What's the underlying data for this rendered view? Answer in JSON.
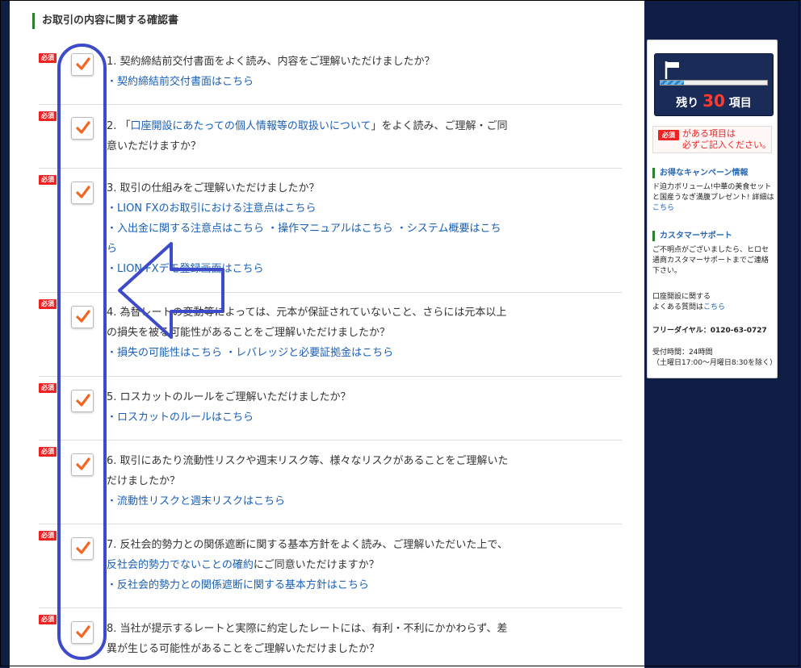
{
  "section_title": "お取引の内容に関する確認書",
  "required_badge": "必須",
  "questions": [
    {
      "text": "1. 契約締結前交付書面をよく読み、内容をご理解いただけましたか？",
      "links": [
        "・契約締結前交付書面はこちら"
      ],
      "checked": true
    },
    {
      "text_before": "2. 「",
      "text_link": "口座開設にあたっての個人情報等の取扱いについて",
      "text_after": "」をよく読み、ご理解・ご同意いただけますか？",
      "links": [],
      "checked": true
    },
    {
      "text": "3. 取引の仕組みをご理解いただけましたか？",
      "links": [
        "・LION FXのお取引における注意点はこちら",
        "・入出金に関する注意点はこちら",
        "・操作マニュアルはこちら",
        "・システム概要はこちら",
        "・LION FXデモ登録画面はこちら"
      ],
      "checked": true
    },
    {
      "text": "4. 為替レートの変動等によっては、元本が保証されていないこと、さらには元本以上の損失を被る可能性があることをご理解いただけましたか？",
      "links": [
        "・損失の可能性はこちら",
        "・レバレッジと必要証拠金はこちら"
      ],
      "checked": true
    },
    {
      "text": "5. ロスカットのルールをご理解いただけましたか？",
      "links": [
        "・ロスカットのルールはこちら"
      ],
      "checked": true
    },
    {
      "text": "6. 取引にあたり流動性リスクや週末リスク等、様々なリスクがあることをご理解いただけましたか？",
      "links": [
        "・流動性リスクと週末リスクはこちら"
      ],
      "checked": true
    },
    {
      "text_before": "7. 反社会的勢力との関係遮断に関する基本方針をよく読み、ご理解いただいた上で、",
      "text_link": "反社会的勢力でないことの確約",
      "text_after": "にご同意いただけますか？",
      "links": [
        "・反社会的勢力との関係遮断に関する基本方針はこちら"
      ],
      "checked": true
    },
    {
      "text": "8. 当社が提示するレートと実際に約定したレートには、有利・不利にかかわらず、差異が生じる可能性があることをご理解いただけましたか？",
      "links": [],
      "checked": true
    }
  ],
  "sidebar": {
    "remaining_prefix": "残り",
    "remaining_count": "30",
    "remaining_suffix": "項目",
    "progress": 0.22,
    "required_note": "がある項目は\n必ずご記入ください。",
    "campaign_heading": "お得なキャンペーン情報",
    "campaign_text": "ド迫力ボリューム!中華の美食セットと国産うなぎ満腹プレゼント! 詳細は",
    "campaign_link": "こちら",
    "support_heading": "カスタマーサポート",
    "support_text": "ご不明点がございましたら、ヒロセ通商カスタマーサポートまでご連絡下さい。",
    "faq_text": "口座開設に関する\nよくある質問は",
    "faq_link": "こちら",
    "freedial": "フリーダイヤル：0120-63-0727",
    "hours": "受付時間：24時間\n（土曜日17:00～月曜日8:30を除く）"
  },
  "colors": {
    "page_background": "#0f1e45",
    "check": "#f26522",
    "annotation": "#3d4ac9",
    "link": "#1a5fb4",
    "required": "#ee2222"
  }
}
